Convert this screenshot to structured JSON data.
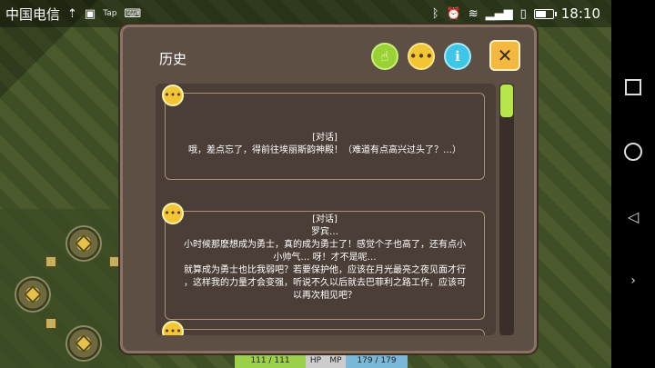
{
  "status_bar": {
    "carrier": "中国电信",
    "signal_label": "ᯤ",
    "tap_label": "Tap",
    "time": "18:10",
    "battery_level": 0.55
  },
  "dialog": {
    "title": "历史",
    "entries": [
      {
        "label": "[对话]",
        "lines": [
          "哦，差点忘了，得前往埃丽斯韵神殿！（难道有点高兴过头了？…）"
        ]
      },
      {
        "label": "[对话]",
        "speaker": "罗宾…",
        "lines": [
          "小时候那麽想成为勇士，真的成为勇士了！感觉个子也高了，还有点小",
          "小帅气… 呀！才不是呢…",
          "就算成为勇士也比我弱吧？若要保护他，应该在月光最亮之夜见面才行",
          "，这样我的力量才会变强，听说不久以后就去巴菲利之路工作，应该可",
          "以再次相见吧？"
        ]
      }
    ]
  },
  "hud": {
    "hp_value": "111 / 111",
    "hp_label": "HP",
    "mp_label": "MP",
    "mp_value": "179 / 179"
  }
}
